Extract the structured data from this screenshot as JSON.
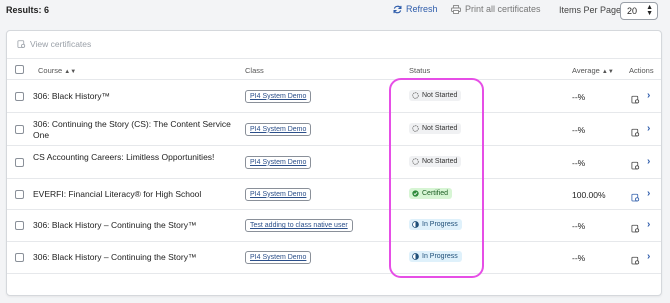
{
  "toolbar": {
    "results": "Results: 6",
    "refresh_label": "Refresh",
    "print_label": "Print all certificates",
    "items_per_page_label": "Items Per Page:",
    "items_per_page_value": "20"
  },
  "panel": {
    "view_certificates_label": "View certificates"
  },
  "table": {
    "headers": {
      "course": "Course",
      "class": "Class",
      "status": "Status",
      "average": "Average",
      "actions": "Actions"
    },
    "rows": [
      {
        "course": "306: Black History™",
        "class": "PI4 System Demo",
        "status": "Not Started",
        "average": "--%"
      },
      {
        "course": "306: Continuing the Story (CS): The Content Service One",
        "class": "PI4 System Demo",
        "status": "Not Started",
        "average": "--%"
      },
      {
        "course": "CS Accounting Careers: Limitless Opportunities!",
        "class": "PI4 System Demo",
        "status": "Not Started",
        "average": "--%"
      },
      {
        "course": "EVERFI: Financial Literacy® for High School",
        "class": "PI4 System Demo",
        "status": "Certified",
        "average": "100.00%"
      },
      {
        "course": "306: Black History – Continuing the Story™",
        "class": "Test adding to class native user",
        "status": "In Progress",
        "average": "--%"
      },
      {
        "course": "306: Black History – Continuing the Story™",
        "class": "PI4 System Demo",
        "status": "In Progress",
        "average": "--%"
      }
    ]
  },
  "colors": {
    "link_blue": "#2f5dab",
    "highlight_magenta": "#e64ee6",
    "certified_bg": "#d7f5d4",
    "in_progress_bg": "#dff1fb",
    "not_started_bg": "#f0f1f3"
  }
}
